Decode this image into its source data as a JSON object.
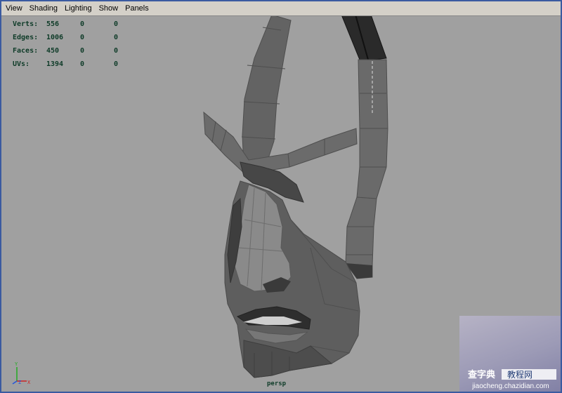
{
  "menubar": {
    "items": [
      "View",
      "Shading",
      "Lighting",
      "Show",
      "Panels"
    ]
  },
  "hud": {
    "rows": [
      {
        "label": "Verts:",
        "v1": "556",
        "v2": "0",
        "v3": "0"
      },
      {
        "label": "Edges:",
        "v1": "1006",
        "v2": "0",
        "v3": "0"
      },
      {
        "label": "Faces:",
        "v1": "450",
        "v2": "0",
        "v3": "0"
      },
      {
        "label": "UVs:",
        "v1": "1394",
        "v2": "0",
        "v3": "0"
      }
    ]
  },
  "viewport": {
    "camera_label": "persp",
    "background_color": "#a0a0a0",
    "mesh_color": "#5c5c5c",
    "selected_edge_color": "#000000"
  },
  "axis": {
    "y": "Y",
    "z": "Z",
    "x": "X"
  },
  "watermark": {
    "logo": "查字典 教程网",
    "url": "jiaocheng.chazidian.com"
  }
}
